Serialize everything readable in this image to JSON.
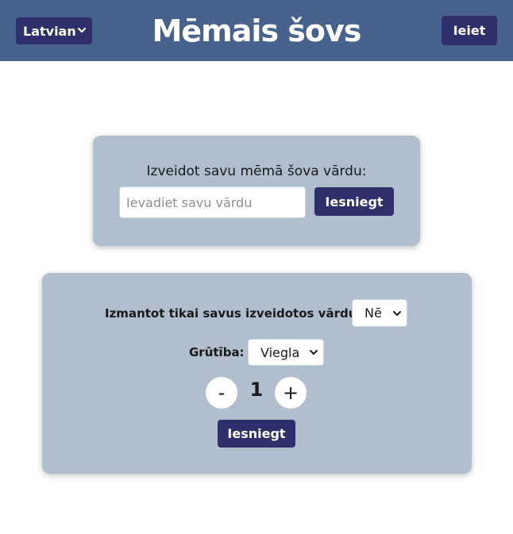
{
  "header": {
    "language_select": {
      "value": "Latvian",
      "icon": "chevron-down-icon"
    },
    "title": "Mēmais šovs",
    "login_label": "Ieiet",
    "colors": {
      "bar": "#47628c",
      "button": "#2f2f6b"
    }
  },
  "create_word": {
    "heading": "Izveidot savu mēmā šova vārdu:",
    "input_placeholder": "Ievadiet savu vārdu",
    "input_value": "",
    "submit_label": "Iesniegt"
  },
  "game_settings": {
    "own_words_label": "Izmantot tikai savus izveidotos vārdus:",
    "own_words_value": "Nē",
    "difficulty_label": "Grūtība:",
    "difficulty_value": "Viegla",
    "minus_label": "-",
    "count": "1",
    "plus_label": "+",
    "submit_label": "Iesniegt"
  },
  "colors": {
    "card": "#b0bece",
    "page": "#ffffff"
  }
}
